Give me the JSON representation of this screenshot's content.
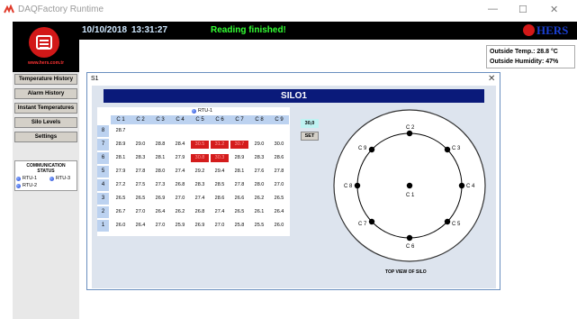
{
  "window": {
    "title": "DAQFactory Runtime",
    "controls": [
      "—",
      "☐",
      "✕"
    ]
  },
  "sidebar": {
    "logo_url": "www.hers.com.tr",
    "buttons": [
      "Temperature History",
      "Alarm History",
      "Instant Temperatures",
      "Silo Levels",
      "Settings"
    ],
    "comm_title_1": "COMMUNICATION",
    "comm_title_2": "STATUS",
    "rtus": [
      "RTU-1",
      "RTU-3",
      "RTU-2"
    ]
  },
  "topbar": {
    "date": "10/10/2018",
    "time": "13:31:27",
    "status": "Reading finished!",
    "brand": "HERS"
  },
  "outside": {
    "temp": "Outside Temp.: 28.8 °C",
    "humidity": "Outside Humidity: 47%"
  },
  "dialog": {
    "title": "S1",
    "close": "✕",
    "silo_name": "SILO1",
    "rtu_label": "RTU-1",
    "columns": [
      "C 1",
      "C 2",
      "C 3",
      "C 4",
      "C 5",
      "C 6",
      "C 7",
      "C 8",
      "C 9"
    ],
    "rows": [
      {
        "label": "8",
        "values": [
          "28.7",
          "",
          "",
          "",
          "",
          "",
          "",
          "",
          ""
        ]
      },
      {
        "label": "7",
        "values": [
          "28.9",
          "29.0",
          "28.8",
          "28.4",
          "30.5",
          "31.2",
          "30.7",
          "29.0",
          "30.0"
        ]
      },
      {
        "label": "6",
        "values": [
          "28.1",
          "28.3",
          "28.1",
          "27.9",
          "30.8",
          "30.3",
          "28.9",
          "28.3",
          "28.6"
        ]
      },
      {
        "label": "5",
        "values": [
          "27.9",
          "27.8",
          "28.0",
          "27.4",
          "29.2",
          "29.4",
          "28.1",
          "27.6",
          "27.8"
        ]
      },
      {
        "label": "4",
        "values": [
          "27.2",
          "27.5",
          "27.3",
          "26.8",
          "28.3",
          "28.5",
          "27.8",
          "28.0",
          "27.0"
        ]
      },
      {
        "label": "3",
        "values": [
          "26.5",
          "26.5",
          "26.9",
          "27.0",
          "27.4",
          "28.6",
          "26.6",
          "26.2",
          "26.5"
        ]
      },
      {
        "label": "2",
        "values": [
          "26.7",
          "27.0",
          "26.4",
          "26.2",
          "26.8",
          "27.4",
          "26.5",
          "26.1",
          "26.4"
        ]
      },
      {
        "label": "1",
        "values": [
          "26.0",
          "26.4",
          "27.0",
          "25.9",
          "26.9",
          "27.0",
          "25.8",
          "25.5",
          "26.0"
        ]
      }
    ],
    "hot_cells": [
      [
        1,
        4
      ],
      [
        1,
        5
      ],
      [
        1,
        6
      ],
      [
        2,
        4
      ],
      [
        2,
        5
      ]
    ],
    "set_value": "30,0",
    "set_button": "SET",
    "cable_labels": [
      "C 1",
      "C 2",
      "C 3",
      "C 4",
      "C 5",
      "C 6",
      "C 7",
      "C 8",
      "C 9"
    ],
    "caption": "TOP VIEW OF SILO"
  },
  "colors": {
    "banner": "#0a1a7a",
    "hot": "#d41c1c",
    "status_ok": "#33ff33",
    "brand_red": "#d21818"
  }
}
